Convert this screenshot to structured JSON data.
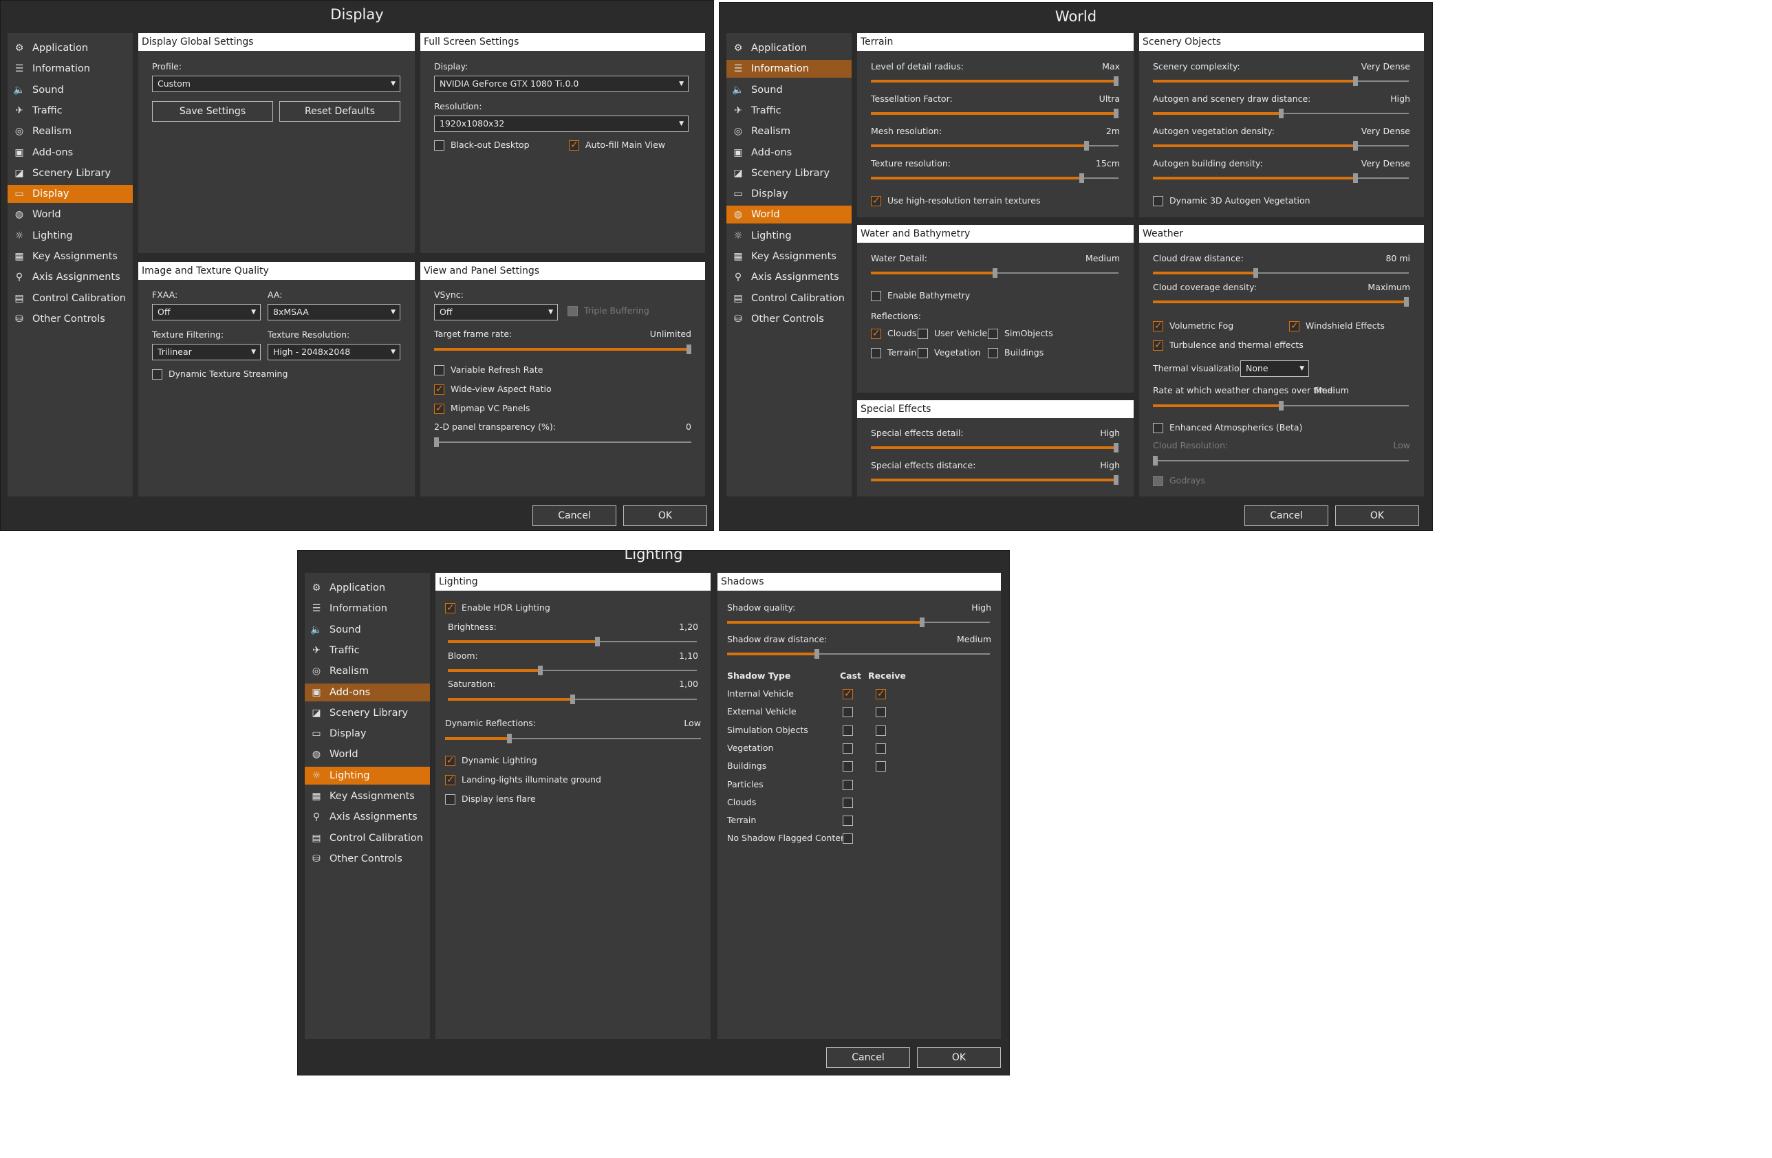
{
  "sidebar_items": [
    {
      "label": "Application",
      "icon": "gears-icon"
    },
    {
      "label": "Information",
      "icon": "list-icon"
    },
    {
      "label": "Sound",
      "icon": "speaker-icon"
    },
    {
      "label": "Traffic",
      "icon": "airplane-icon"
    },
    {
      "label": "Realism",
      "icon": "gauge-icon"
    },
    {
      "label": "Add-ons",
      "icon": "addon-icon"
    },
    {
      "label": "Scenery Library",
      "icon": "globe-square-icon"
    },
    {
      "label": "Display",
      "icon": "monitor-icon"
    },
    {
      "label": "World",
      "icon": "globe-icon"
    },
    {
      "label": "Lighting",
      "icon": "sun-icon"
    },
    {
      "label": "Key Assignments",
      "icon": "keyboard-icon"
    },
    {
      "label": "Axis Assignments",
      "icon": "joystick-icon"
    },
    {
      "label": "Control Calibration",
      "icon": "calibration-icon"
    },
    {
      "label": "Other Controls",
      "icon": "cylinder-icon"
    }
  ],
  "buttons": {
    "cancel": "Cancel",
    "ok": "OK"
  },
  "display": {
    "title": "Display",
    "global": {
      "header": "Display Global Settings",
      "profile_label": "Profile:",
      "profile_value": "Custom",
      "save": "Save Settings",
      "reset": "Reset Defaults"
    },
    "fullscreen": {
      "header": "Full Screen Settings",
      "display_label": "Display:",
      "display_value": "NVIDIA GeForce GTX 1080 Ti.0.0",
      "resolution_label": "Resolution:",
      "resolution_value": "1920x1080x32",
      "blackout": "Black-out Desktop",
      "autofill": "Auto-fill Main View"
    },
    "image": {
      "header": "Image and Texture Quality",
      "fxaa_label": "FXAA:",
      "fxaa_value": "Off",
      "aa_label": "AA:",
      "aa_value": "8xMSAA",
      "filter_label": "Texture Filtering:",
      "filter_value": "Trilinear",
      "res_label": "Texture Resolution:",
      "res_value": "High - 2048x2048",
      "streaming": "Dynamic Texture Streaming"
    },
    "view": {
      "header": "View and Panel Settings",
      "vsync_label": "VSync:",
      "vsync_value": "Off",
      "triple": "Triple Buffering",
      "frame_label": "Target frame rate:",
      "frame_value": "Unlimited",
      "frame_level": 1.0,
      "vrr": "Variable Refresh Rate",
      "wide": "Wide-view Aspect Ratio",
      "mipmap": "Mipmap VC Panels",
      "transp_label": "2-D panel transparency (%):",
      "transp_value": "0",
      "transp_level": 0.0
    }
  },
  "world": {
    "title": "World",
    "terrain": {
      "header": "Terrain",
      "rows": [
        {
          "label": "Level of detail radius:",
          "value": "Max",
          "level": 1.0
        },
        {
          "label": "Tessellation Factor:",
          "value": "Ultra",
          "level": 1.0
        },
        {
          "label": "Mesh resolution:",
          "value": "2m",
          "level": 0.87
        },
        {
          "label": "Texture resolution:",
          "value": "15cm",
          "level": 0.85
        }
      ],
      "hires": "Use high-resolution terrain textures"
    },
    "scenery": {
      "header": "Scenery Objects",
      "rows": [
        {
          "label": "Scenery complexity:",
          "value": "Very Dense",
          "level": 0.79
        },
        {
          "label": "Autogen and scenery draw distance:",
          "value": "High",
          "level": 0.5
        },
        {
          "label": "Autogen vegetation density:",
          "value": "Very Dense",
          "level": 0.79
        },
        {
          "label": "Autogen building density:",
          "value": "Very Dense",
          "level": 0.79
        }
      ],
      "dyn3d": "Dynamic 3D Autogen Vegetation"
    },
    "water": {
      "header": "Water and Bathymetry",
      "detail_label": "Water Detail:",
      "detail_value": "Medium",
      "detail_level": 0.5,
      "bathy": "Enable Bathymetry",
      "reflections": "Reflections:",
      "refl_items": [
        "Clouds",
        "User Vehicle",
        "SimObjects",
        "Terrain",
        "Vegetation",
        "Buildings"
      ]
    },
    "special": {
      "header": "Special Effects",
      "detail_label": "Special effects detail:",
      "detail_value": "High",
      "detail_level": 1.0,
      "dist_label": "Special effects distance:",
      "dist_value": "High",
      "dist_level": 1.0
    },
    "weather": {
      "header": "Weather",
      "cloud_dist_label": "Cloud draw distance:",
      "cloud_dist_value": "80 mi",
      "cloud_dist_level": 0.4,
      "coverage_label": "Cloud coverage density:",
      "coverage_value": "Maximum",
      "coverage_level": 1.0,
      "fog": "Volumetric Fog",
      "windshield": "Windshield Effects",
      "turbulence": "Turbulence and thermal effects",
      "thermal_label": "Thermal visualization:",
      "thermal_value": "None",
      "rate_label": "Rate at which weather changes over time:",
      "rate_value": "Medium",
      "rate_level": 0.5,
      "atmos": "Enhanced Atmospherics (Beta)",
      "cloud_res_label": "Cloud Resolution:",
      "cloud_res_value": "Low",
      "cloud_res_level": 0.0,
      "godrays": "Godrays"
    }
  },
  "lighting": {
    "title": "Lighting",
    "lighting_panel": {
      "header": "Lighting",
      "hdr": "Enable HDR Lighting",
      "brightness_label": "Brightness:",
      "brightness_value": "1,20",
      "brightness_level": 0.6,
      "bloom_label": "Bloom:",
      "bloom_value": "1,10",
      "bloom_level": 0.37,
      "saturation_label": "Saturation:",
      "saturation_value": "1,00",
      "saturation_level": 0.5,
      "dynref_label": "Dynamic Reflections:",
      "dynref_value": "Low",
      "dynref_level": 0.25,
      "dynlight": "Dynamic Lighting",
      "landing": "Landing-lights illuminate ground",
      "lensflare": "Display lens flare"
    },
    "shadows": {
      "header": "Shadows",
      "quality_label": "Shadow quality:",
      "quality_value": "High",
      "quality_level": 0.74,
      "dist_label": "Shadow draw distance:",
      "dist_value": "Medium",
      "dist_level": 0.34,
      "col_type": "Shadow Type",
      "col_cast": "Cast",
      "col_receive": "Receive",
      "rows": [
        {
          "label": "Internal Vehicle",
          "cast": true,
          "receive": true
        },
        {
          "label": "External Vehicle",
          "cast": false,
          "receive": false
        },
        {
          "label": "Simulation Objects",
          "cast": false,
          "receive": false
        },
        {
          "label": "Vegetation",
          "cast": false,
          "receive": false
        },
        {
          "label": "Buildings",
          "cast": false,
          "receive": false
        },
        {
          "label": "Particles",
          "cast": false
        },
        {
          "label": "Clouds",
          "cast": false
        },
        {
          "label": "Terrain",
          "cast": false
        },
        {
          "label": "No Shadow Flagged Content",
          "cast": false
        }
      ]
    }
  }
}
